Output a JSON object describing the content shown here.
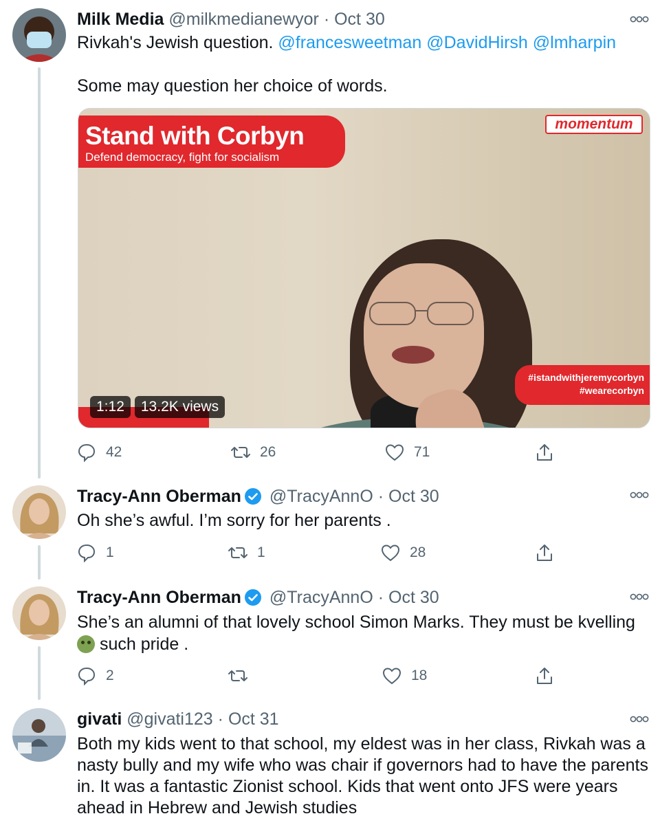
{
  "tweets": [
    {
      "name": "Milk Media",
      "handle": "@milkmedianewyor",
      "dot": "·",
      "date": "Oct 30",
      "text_line1": "Rivkah's Jewish question.",
      "mentions": [
        "@francesweetman",
        "@DavidHirsh",
        "@lmharpin"
      ],
      "text_line2": "Some may question her choice of words.",
      "media": {
        "banner_title": "Stand with Corbyn",
        "banner_sub": "Defend democracy, fight for socialism",
        "logo": "momentum",
        "hashtag1": "#istandwithjeremycorbyn",
        "hashtag2": "#wearecorbyn",
        "duration": "1:12",
        "views": "13.2K views"
      },
      "replies": "42",
      "retweets": "26",
      "likes": "71"
    },
    {
      "name": "Tracy-Ann Oberman",
      "handle": "@TracyAnnO",
      "dot": "·",
      "date": "Oct 30",
      "text": "Oh she’s awful. I’m sorry for her parents .",
      "replies": "1",
      "retweets": "1",
      "likes": "28"
    },
    {
      "name": "Tracy-Ann Oberman",
      "handle": "@TracyAnnO",
      "dot": "·",
      "date": "Oct 30",
      "text_line1": "She’s an alumni of that lovely school Simon Marks. They must be kvelling",
      "text_line2": "such pride .",
      "replies": "2",
      "retweets": "",
      "likes": "18"
    },
    {
      "name": "givati",
      "handle": "@givati123",
      "dot": "·",
      "date": "Oct 31",
      "text": "Both my kids went to that school, my eldest was in her class, Rivkah was a nasty bully and my wife who was chair if governors had to have the parents in. It was a fantastic Zionist school. Kids that went onto JFS were years ahead in Hebrew and Jewish studies"
    }
  ],
  "colors": {
    "link": "#1d9bf0",
    "secondary_text": "#536471",
    "thread_line": "#cfd9de",
    "verified": "#1d9bf0",
    "momentum_red": "#e0282d"
  },
  "icons": [
    "more-icon",
    "reply-icon",
    "retweet-icon",
    "like-icon",
    "share-icon",
    "verified-icon",
    "nauseated-face-emoji"
  ]
}
